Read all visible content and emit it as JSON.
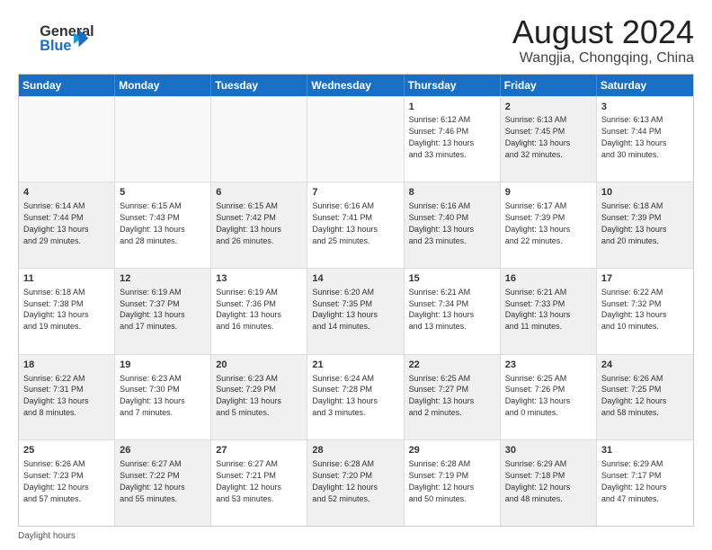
{
  "logo": {
    "line1": "General",
    "line2": "Blue",
    "icon": "▶"
  },
  "title": "August 2024",
  "subtitle": "Wangjia, Chongqing, China",
  "days_of_week": [
    "Sunday",
    "Monday",
    "Tuesday",
    "Wednesday",
    "Thursday",
    "Friday",
    "Saturday"
  ],
  "footer": "Daylight hours",
  "weeks": [
    [
      {
        "day": "",
        "info": "",
        "empty": true
      },
      {
        "day": "",
        "info": "",
        "empty": true
      },
      {
        "day": "",
        "info": "",
        "empty": true
      },
      {
        "day": "",
        "info": "",
        "empty": true
      },
      {
        "day": "1",
        "info": "Sunrise: 6:12 AM\nSunset: 7:46 PM\nDaylight: 13 hours\nand 33 minutes.",
        "shaded": false
      },
      {
        "day": "2",
        "info": "Sunrise: 6:13 AM\nSunset: 7:45 PM\nDaylight: 13 hours\nand 32 minutes.",
        "shaded": true
      },
      {
        "day": "3",
        "info": "Sunrise: 6:13 AM\nSunset: 7:44 PM\nDaylight: 13 hours\nand 30 minutes.",
        "shaded": false
      }
    ],
    [
      {
        "day": "4",
        "info": "Sunrise: 6:14 AM\nSunset: 7:44 PM\nDaylight: 13 hours\nand 29 minutes.",
        "shaded": true
      },
      {
        "day": "5",
        "info": "Sunrise: 6:15 AM\nSunset: 7:43 PM\nDaylight: 13 hours\nand 28 minutes.",
        "shaded": false
      },
      {
        "day": "6",
        "info": "Sunrise: 6:15 AM\nSunset: 7:42 PM\nDaylight: 13 hours\nand 26 minutes.",
        "shaded": true
      },
      {
        "day": "7",
        "info": "Sunrise: 6:16 AM\nSunset: 7:41 PM\nDaylight: 13 hours\nand 25 minutes.",
        "shaded": false
      },
      {
        "day": "8",
        "info": "Sunrise: 6:16 AM\nSunset: 7:40 PM\nDaylight: 13 hours\nand 23 minutes.",
        "shaded": true
      },
      {
        "day": "9",
        "info": "Sunrise: 6:17 AM\nSunset: 7:39 PM\nDaylight: 13 hours\nand 22 minutes.",
        "shaded": false
      },
      {
        "day": "10",
        "info": "Sunrise: 6:18 AM\nSunset: 7:39 PM\nDaylight: 13 hours\nand 20 minutes.",
        "shaded": true
      }
    ],
    [
      {
        "day": "11",
        "info": "Sunrise: 6:18 AM\nSunset: 7:38 PM\nDaylight: 13 hours\nand 19 minutes.",
        "shaded": false
      },
      {
        "day": "12",
        "info": "Sunrise: 6:19 AM\nSunset: 7:37 PM\nDaylight: 13 hours\nand 17 minutes.",
        "shaded": true
      },
      {
        "day": "13",
        "info": "Sunrise: 6:19 AM\nSunset: 7:36 PM\nDaylight: 13 hours\nand 16 minutes.",
        "shaded": false
      },
      {
        "day": "14",
        "info": "Sunrise: 6:20 AM\nSunset: 7:35 PM\nDaylight: 13 hours\nand 14 minutes.",
        "shaded": true
      },
      {
        "day": "15",
        "info": "Sunrise: 6:21 AM\nSunset: 7:34 PM\nDaylight: 13 hours\nand 13 minutes.",
        "shaded": false
      },
      {
        "day": "16",
        "info": "Sunrise: 6:21 AM\nSunset: 7:33 PM\nDaylight: 13 hours\nand 11 minutes.",
        "shaded": true
      },
      {
        "day": "17",
        "info": "Sunrise: 6:22 AM\nSunset: 7:32 PM\nDaylight: 13 hours\nand 10 minutes.",
        "shaded": false
      }
    ],
    [
      {
        "day": "18",
        "info": "Sunrise: 6:22 AM\nSunset: 7:31 PM\nDaylight: 13 hours\nand 8 minutes.",
        "shaded": true
      },
      {
        "day": "19",
        "info": "Sunrise: 6:23 AM\nSunset: 7:30 PM\nDaylight: 13 hours\nand 7 minutes.",
        "shaded": false
      },
      {
        "day": "20",
        "info": "Sunrise: 6:23 AM\nSunset: 7:29 PM\nDaylight: 13 hours\nand 5 minutes.",
        "shaded": true
      },
      {
        "day": "21",
        "info": "Sunrise: 6:24 AM\nSunset: 7:28 PM\nDaylight: 13 hours\nand 3 minutes.",
        "shaded": false
      },
      {
        "day": "22",
        "info": "Sunrise: 6:25 AM\nSunset: 7:27 PM\nDaylight: 13 hours\nand 2 minutes.",
        "shaded": true
      },
      {
        "day": "23",
        "info": "Sunrise: 6:25 AM\nSunset: 7:26 PM\nDaylight: 13 hours\nand 0 minutes.",
        "shaded": false
      },
      {
        "day": "24",
        "info": "Sunrise: 6:26 AM\nSunset: 7:25 PM\nDaylight: 12 hours\nand 58 minutes.",
        "shaded": true
      }
    ],
    [
      {
        "day": "25",
        "info": "Sunrise: 6:26 AM\nSunset: 7:23 PM\nDaylight: 12 hours\nand 57 minutes.",
        "shaded": false
      },
      {
        "day": "26",
        "info": "Sunrise: 6:27 AM\nSunset: 7:22 PM\nDaylight: 12 hours\nand 55 minutes.",
        "shaded": true
      },
      {
        "day": "27",
        "info": "Sunrise: 6:27 AM\nSunset: 7:21 PM\nDaylight: 12 hours\nand 53 minutes.",
        "shaded": false
      },
      {
        "day": "28",
        "info": "Sunrise: 6:28 AM\nSunset: 7:20 PM\nDaylight: 12 hours\nand 52 minutes.",
        "shaded": true
      },
      {
        "day": "29",
        "info": "Sunrise: 6:28 AM\nSunset: 7:19 PM\nDaylight: 12 hours\nand 50 minutes.",
        "shaded": false
      },
      {
        "day": "30",
        "info": "Sunrise: 6:29 AM\nSunset: 7:18 PM\nDaylight: 12 hours\nand 48 minutes.",
        "shaded": true
      },
      {
        "day": "31",
        "info": "Sunrise: 6:29 AM\nSunset: 7:17 PM\nDaylight: 12 hours\nand 47 minutes.",
        "shaded": false
      }
    ]
  ]
}
